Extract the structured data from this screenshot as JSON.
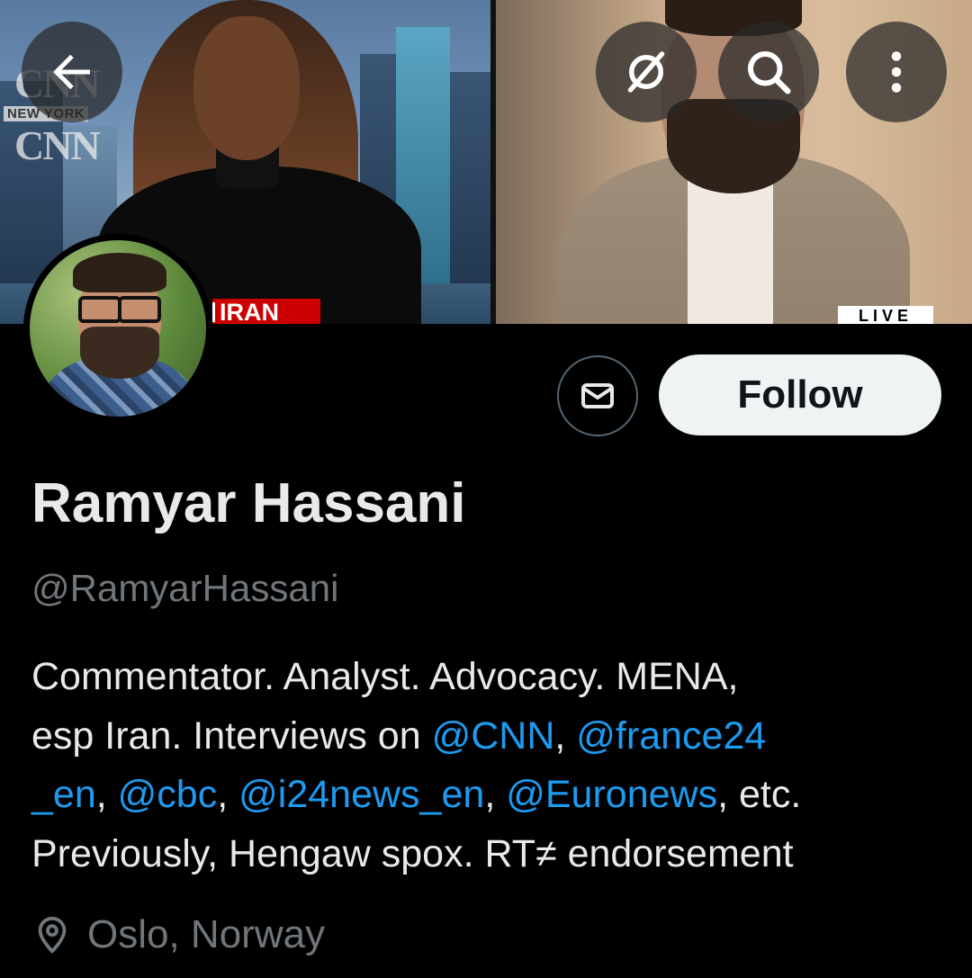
{
  "banner": {
    "left_logo_1": "CNN",
    "left_location_tag": "NEW YORK",
    "left_logo_2": "CNN",
    "left_topic_tag": "IRAN",
    "right_live_tag": "LIVE"
  },
  "header": {
    "back_icon": "arrow-left-icon",
    "grok_icon": "grok-icon",
    "search_icon": "search-icon",
    "more_icon": "more-vertical-icon"
  },
  "profile": {
    "display_name": "Ramyar Hassani",
    "handle": "@RamyarHassani",
    "follow_label": "Follow",
    "message_icon": "envelope-icon",
    "bio": {
      "line1": "Commentator. Analyst. Advocacy. MENA,",
      "line2_text": "esp Iran. Interviews on ",
      "mention_cnn": "@CNN",
      "line2_sep": ", ",
      "mention_france24_a": "@france24",
      "mention_france24_b": "_en",
      "line3_sep1": ", ",
      "mention_cbc": "@cbc",
      "line3_sep2": ", ",
      "mention_i24": "@i24news_en",
      "line3_sep3": ", ",
      "mention_euronews": "@Euronews",
      "line3_end": ", etc.",
      "line4": "Previously, Hengaw spox. RT≠ endorsement"
    },
    "location": "Oslo, Norway",
    "location_icon": "location-pin-icon"
  },
  "colors": {
    "background": "#000000",
    "text_primary": "#e7e9ea",
    "text_secondary": "#71767b",
    "link": "#1d9bf0",
    "follow_bg": "#eff3f4",
    "follow_text": "#0f1419"
  }
}
